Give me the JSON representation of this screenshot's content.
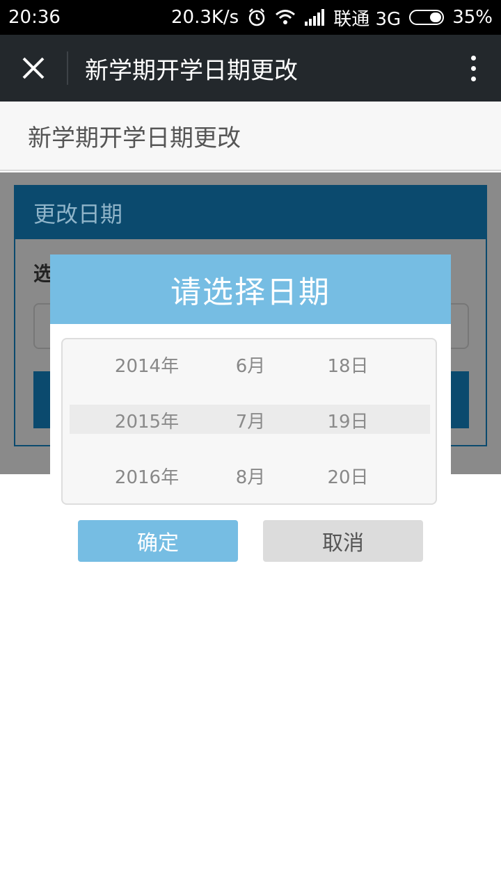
{
  "status_bar": {
    "time": "20:36",
    "speed": "20.3K/s",
    "carrier": "联通 3G",
    "battery": "35%"
  },
  "title_bar": {
    "title": "新学期开学日期更改"
  },
  "page": {
    "header": "新学期开学日期更改",
    "panel_title": "更改日期",
    "panel_label": "选"
  },
  "dialog": {
    "title": "请选择日期",
    "rows": [
      {
        "year": "2014年",
        "month": "6月",
        "day": "18日"
      },
      {
        "year": "2015年",
        "month": "7月",
        "day": "19日"
      },
      {
        "year": "2016年",
        "month": "8月",
        "day": "20日"
      }
    ],
    "confirm_label": "确定",
    "cancel_label": "取消"
  },
  "colors": {
    "accent": "#76bde3",
    "panel_header": "#0b4a6e",
    "title_bar": "#23282c"
  }
}
